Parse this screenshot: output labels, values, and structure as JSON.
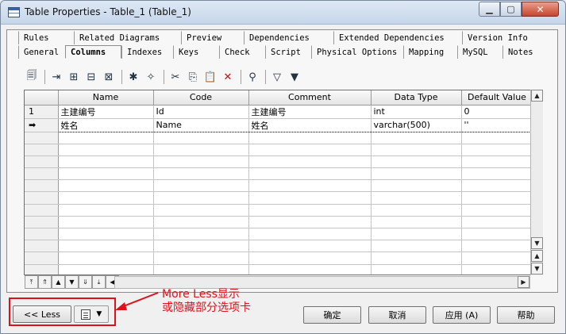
{
  "window": {
    "title": "Table Properties - Table_1 (Table_1)",
    "controls": {
      "minimize": "▁",
      "maximize": "▢",
      "close": "✕"
    }
  },
  "tabs": {
    "back_row": [
      "Rules",
      "Related Diagrams",
      "Preview",
      "Dependencies",
      "Extended Dependencies",
      "Version Info"
    ],
    "front_row": [
      "General",
      "Columns",
      "Indexes",
      "Keys",
      "Check",
      "Script",
      "Physical Options",
      "Mapping",
      "MySQL",
      "Notes"
    ],
    "active": "Columns"
  },
  "toolbar": {
    "icons": [
      "properties-icon",
      "insert-row-icon",
      "add-row-icon",
      "add-columns-icon",
      "replace-columns-icon",
      "new-wizard-icon",
      "find-wizard-icon",
      "cut-icon",
      "copy-icon",
      "paste-icon",
      "delete-icon",
      "find-icon",
      "customize-columns-filter-icon",
      "filter-icon"
    ],
    "glyphs": [
      "🗐",
      "⇥",
      "⊞",
      "⊟",
      "⊠",
      "✱",
      "✧",
      "✂",
      "⎘",
      "📋",
      "✕",
      "⚲",
      "▽",
      "▼"
    ]
  },
  "grid": {
    "columns": [
      "Name",
      "Code",
      "Comment",
      "Data Type",
      "Default Value"
    ],
    "rows": [
      {
        "marker": "1",
        "name": "主建编号",
        "code": "Id",
        "comment": "主建编号",
        "data_type": "int",
        "default": "0"
      },
      {
        "marker": "➡",
        "name": "姓名",
        "code": "Name",
        "comment": "姓名",
        "data_type": "varchar(500)",
        "default": "''"
      }
    ]
  },
  "nav_buttons": [
    "⤒",
    "⇑",
    "▲",
    "▼",
    "⇓",
    "⤓",
    "◀"
  ],
  "scroll": {
    "up": "▲",
    "down": "▼",
    "left": "◀",
    "right": "▶"
  },
  "footer": {
    "less_label": "<< Less",
    "dropdown_glyph": "▼",
    "ok_label": "确定",
    "cancel_label": "取消",
    "apply_label": "应用 (A)",
    "help_label": "帮助"
  },
  "annotation": {
    "line1": "More Less显示",
    "line2": "或隐藏部分选项卡",
    "color": "#e0101a"
  }
}
